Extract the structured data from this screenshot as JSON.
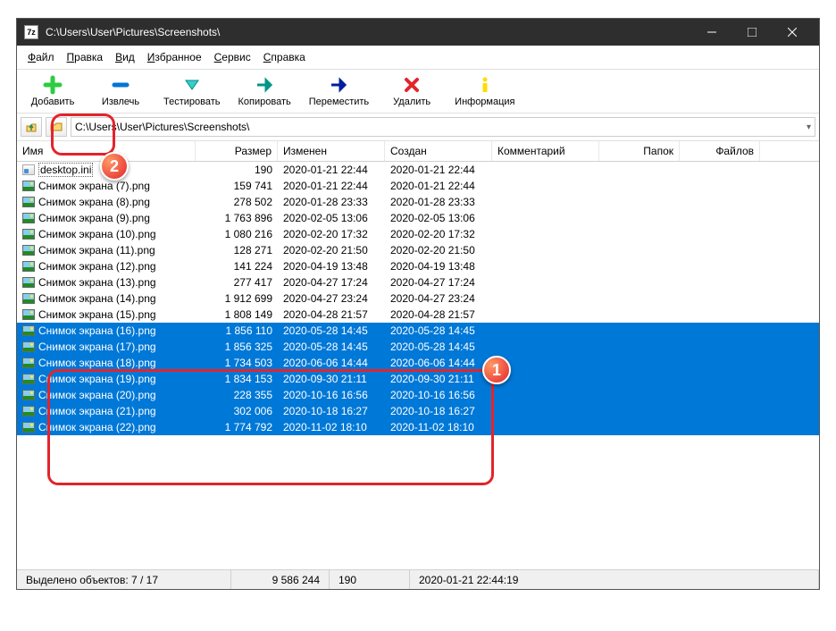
{
  "title": "C:\\Users\\User\\Pictures\\Screenshots\\",
  "appIcon": "7z",
  "menu": [
    "Файл",
    "Правка",
    "Вид",
    "Избранное",
    "Сервис",
    "Справка"
  ],
  "toolbar": [
    {
      "name": "add",
      "label": "Добавить",
      "icon": "plus-green"
    },
    {
      "name": "extract",
      "label": "Извлечь",
      "icon": "minus-blue"
    },
    {
      "name": "test",
      "label": "Тестировать",
      "icon": "arrow-down-cyan"
    },
    {
      "name": "copy",
      "label": "Копировать",
      "icon": "arrow-right-teal"
    },
    {
      "name": "move",
      "label": "Переместить",
      "icon": "arrow-right-blue"
    },
    {
      "name": "delete",
      "label": "Удалить",
      "icon": "cross-red"
    },
    {
      "name": "info",
      "label": "Информация",
      "icon": "info-yellow"
    }
  ],
  "path": "C:\\Users\\User\\Pictures\\Screenshots\\",
  "columns": {
    "name": "Имя",
    "size": "Размер",
    "modified": "Изменен",
    "created": "Создан",
    "comment": "Комментарий",
    "folders": "Папок",
    "files": "Файлов"
  },
  "rows": [
    {
      "name": "desktop.ini",
      "size": "190",
      "mod": "2020-01-21 22:44",
      "cre": "2020-01-21 22:44",
      "icon": "ini",
      "sel": false,
      "first": true
    },
    {
      "name": "Снимок экрана (7).png",
      "size": "159 741",
      "mod": "2020-01-21 22:44",
      "cre": "2020-01-21 22:44",
      "icon": "img",
      "sel": false
    },
    {
      "name": "Снимок экрана (8).png",
      "size": "278 502",
      "mod": "2020-01-28 23:33",
      "cre": "2020-01-28 23:33",
      "icon": "img",
      "sel": false
    },
    {
      "name": "Снимок экрана (9).png",
      "size": "1 763 896",
      "mod": "2020-02-05 13:06",
      "cre": "2020-02-05 13:06",
      "icon": "img",
      "sel": false
    },
    {
      "name": "Снимок экрана (10).png",
      "size": "1 080 216",
      "mod": "2020-02-20 17:32",
      "cre": "2020-02-20 17:32",
      "icon": "img",
      "sel": false
    },
    {
      "name": "Снимок экрана (11).png",
      "size": "128 271",
      "mod": "2020-02-20 21:50",
      "cre": "2020-02-20 21:50",
      "icon": "img",
      "sel": false
    },
    {
      "name": "Снимок экрана (12).png",
      "size": "141 224",
      "mod": "2020-04-19 13:48",
      "cre": "2020-04-19 13:48",
      "icon": "img",
      "sel": false
    },
    {
      "name": "Снимок экрана (13).png",
      "size": "277 417",
      "mod": "2020-04-27 17:24",
      "cre": "2020-04-27 17:24",
      "icon": "img",
      "sel": false
    },
    {
      "name": "Снимок экрана (14).png",
      "size": "1 912 699",
      "mod": "2020-04-27 23:24",
      "cre": "2020-04-27 23:24",
      "icon": "img",
      "sel": false
    },
    {
      "name": "Снимок экрана (15).png",
      "size": "1 808 149",
      "mod": "2020-04-28 21:57",
      "cre": "2020-04-28 21:57",
      "icon": "img",
      "sel": false
    },
    {
      "name": "Снимок экрана (16).png",
      "size": "1 856 110",
      "mod": "2020-05-28 14:45",
      "cre": "2020-05-28 14:45",
      "icon": "img",
      "sel": true
    },
    {
      "name": "Снимок экрана (17).png",
      "size": "1 856 325",
      "mod": "2020-05-28 14:45",
      "cre": "2020-05-28 14:45",
      "icon": "img",
      "sel": true
    },
    {
      "name": "Снимок экрана (18).png",
      "size": "1 734 503",
      "mod": "2020-06-06 14:44",
      "cre": "2020-06-06 14:44",
      "icon": "img",
      "sel": true
    },
    {
      "name": "Снимок экрана (19).png",
      "size": "1 834 153",
      "mod": "2020-09-30 21:11",
      "cre": "2020-09-30 21:11",
      "icon": "img",
      "sel": true
    },
    {
      "name": "Снимок экрана (20).png",
      "size": "228 355",
      "mod": "2020-10-16 16:56",
      "cre": "2020-10-16 16:56",
      "icon": "img",
      "sel": true
    },
    {
      "name": "Снимок экрана (21).png",
      "size": "302 006",
      "mod": "2020-10-18 16:27",
      "cre": "2020-10-18 16:27",
      "icon": "img",
      "sel": true
    },
    {
      "name": "Снимок экрана (22).png",
      "size": "1 774 792",
      "mod": "2020-11-02 18:10",
      "cre": "2020-11-02 18:10",
      "icon": "img",
      "sel": true
    }
  ],
  "status": {
    "selection": "Выделено объектов: 7 / 17",
    "totalSize": "9 586 244",
    "current": "190",
    "date": "2020-01-21 22:44:19"
  },
  "markers": {
    "m1": "1",
    "m2": "2"
  }
}
